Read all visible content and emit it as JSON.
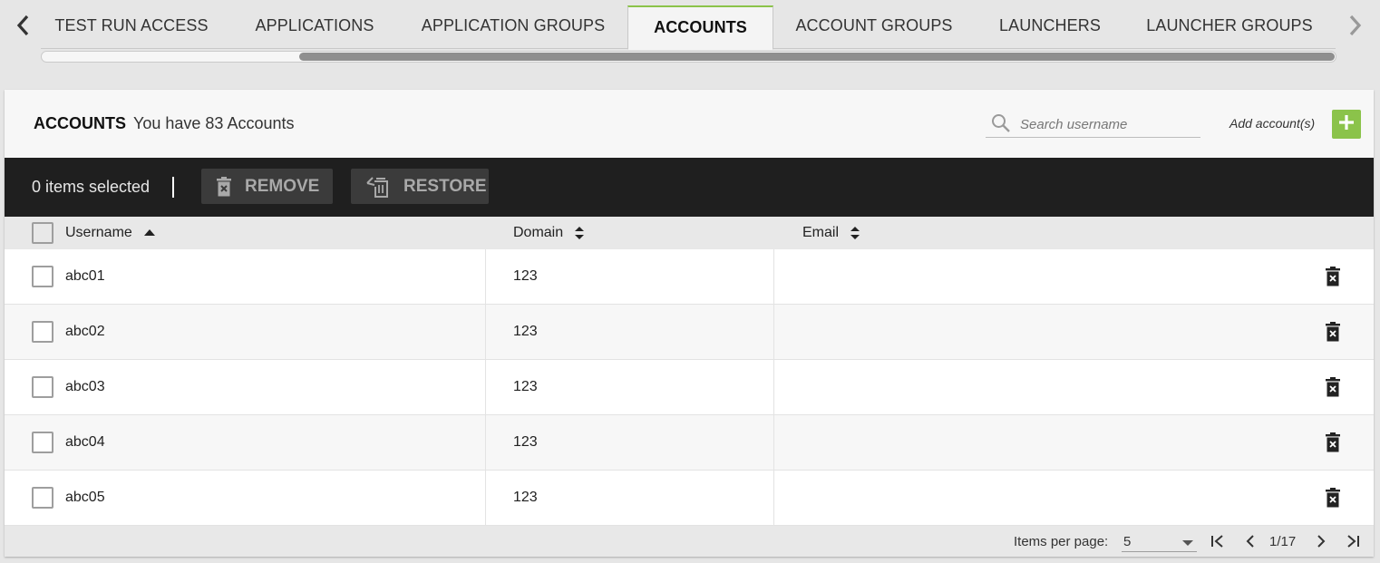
{
  "tabs": [
    {
      "label": "TEST RUN ACCESS"
    },
    {
      "label": "APPLICATIONS"
    },
    {
      "label": "APPLICATION GROUPS"
    },
    {
      "label": "ACCOUNTS",
      "active": true
    },
    {
      "label": "ACCOUNT GROUPS"
    },
    {
      "label": "LAUNCHERS"
    },
    {
      "label": "LAUNCHER GROUPS"
    }
  ],
  "header": {
    "title": "ACCOUNTS",
    "subtitle": "You have 83 Accounts",
    "search_placeholder": "Search username",
    "search_value": "",
    "add_label": "Add account(s)"
  },
  "toolbar": {
    "selected_text": "0 items selected",
    "remove_label": "REMOVE",
    "restore_label": "RESTORE"
  },
  "table": {
    "columns": [
      "Username",
      "Domain",
      "Email"
    ],
    "sort": {
      "column": "Username",
      "direction": "ascending"
    },
    "rows": [
      {
        "username": "abc01",
        "domain": "123",
        "email": ""
      },
      {
        "username": "abc02",
        "domain": "123",
        "email": ""
      },
      {
        "username": "abc03",
        "domain": "123",
        "email": ""
      },
      {
        "username": "abc04",
        "domain": "123",
        "email": ""
      },
      {
        "username": "abc05",
        "domain": "123",
        "email": ""
      }
    ]
  },
  "pagination": {
    "items_per_page_label": "Items per page:",
    "items_per_page": "5",
    "page_indicator": "1/17"
  },
  "colors": {
    "accent": "#8bc34a",
    "toolbar_bg": "#1f1f1f"
  },
  "icons": {
    "prev_tab": "chevron-left-icon",
    "next_tab": "chevron-right-icon",
    "search": "search-icon",
    "add": "plus-icon",
    "remove": "trash-icon",
    "restore": "restore-icon",
    "row_delete": "trash-icon"
  }
}
